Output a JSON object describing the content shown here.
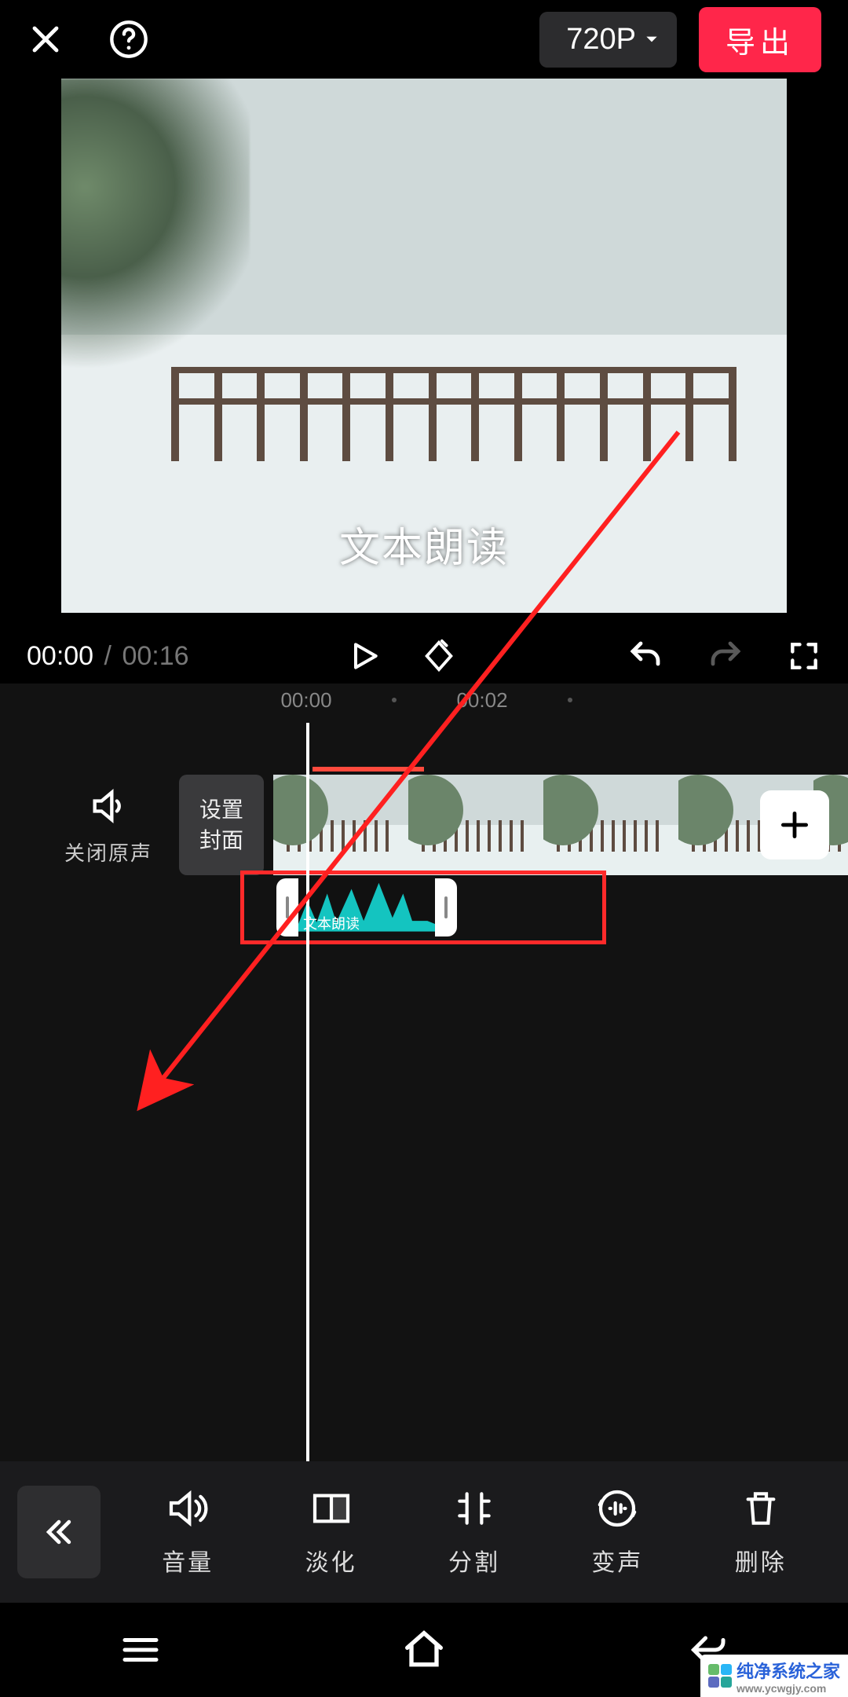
{
  "header": {
    "resolution_label": "720P",
    "export_label": "导出"
  },
  "preview": {
    "overlay_text": "文本朗读"
  },
  "playback": {
    "current_time": "00:00",
    "separator": "/",
    "duration": "00:16"
  },
  "ruler": {
    "ticks": [
      "00:00",
      "00:02"
    ]
  },
  "mute": {
    "label": "关闭原声"
  },
  "cover_button": {
    "line1": "设置",
    "line2": "封面"
  },
  "audio_clip": {
    "label": "文本朗读"
  },
  "toolbar": {
    "items": [
      {
        "id": "volume",
        "label": "音量"
      },
      {
        "id": "fade",
        "label": "淡化"
      },
      {
        "id": "split",
        "label": "分割"
      },
      {
        "id": "voice",
        "label": "变声"
      },
      {
        "id": "delete",
        "label": "删除"
      }
    ]
  },
  "watermark": {
    "name": "纯净系统之家",
    "url": "www.ycwgjy.com"
  }
}
